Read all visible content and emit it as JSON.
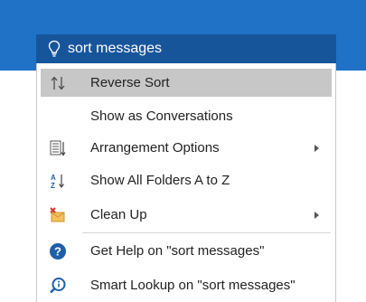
{
  "search": {
    "value": "sort messages",
    "icon": "lightbulb-icon"
  },
  "menu": {
    "items": [
      {
        "label": "Reverse Sort",
        "icon": "reverse-sort-icon",
        "submenu": false
      },
      {
        "label": "Show as Conversations",
        "icon": "",
        "submenu": false
      },
      {
        "label": "Arrangement Options",
        "icon": "arrangement-icon",
        "submenu": true
      },
      {
        "label": "Show All Folders A to Z",
        "icon": "sort-az-icon",
        "submenu": false
      },
      {
        "label": "Clean Up",
        "icon": "clean-up-icon",
        "submenu": true
      },
      {
        "label": "Get Help on \"sort messages\"",
        "icon": "help-icon",
        "submenu": false
      },
      {
        "label": "Smart Lookup on \"sort messages\"",
        "icon": "smart-lookup-icon",
        "submenu": false
      }
    ]
  },
  "colors": {
    "header": "#1f72c6",
    "search_box": "#17559b",
    "hover": "#c7c7c7",
    "help_blue": "#1f5fa8"
  }
}
